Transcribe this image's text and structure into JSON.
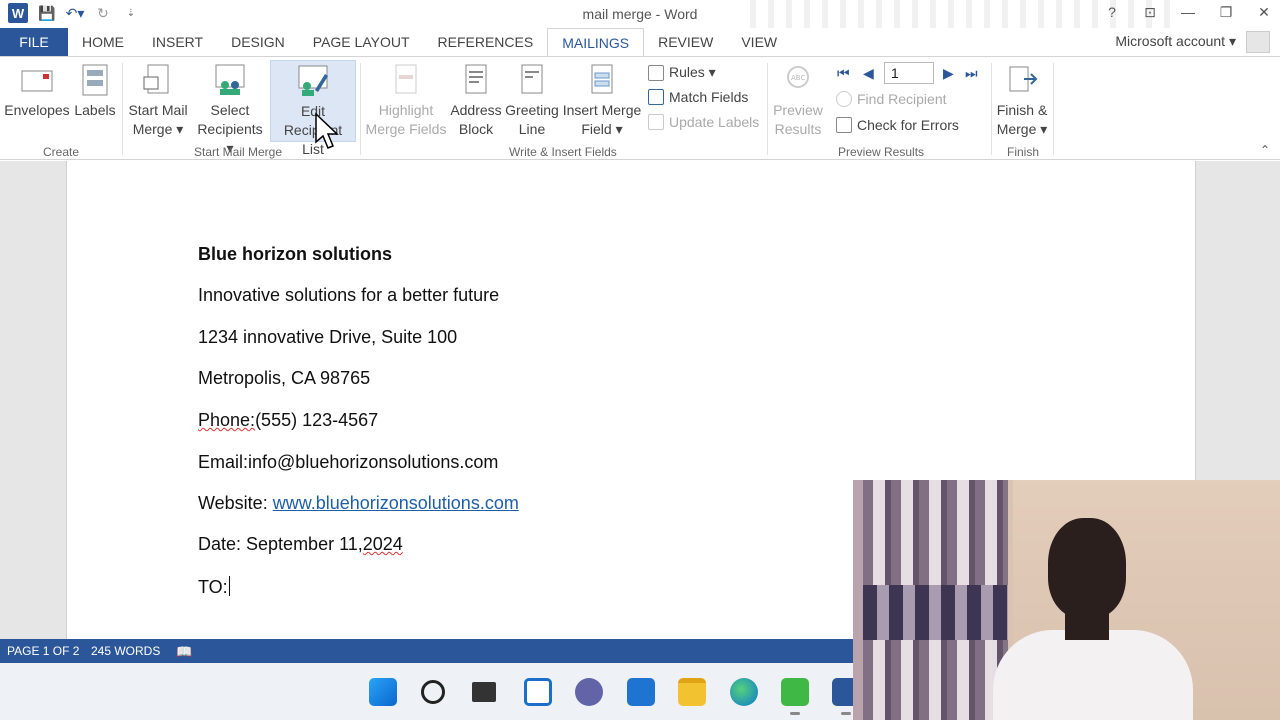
{
  "window": {
    "title": "mail merge - Word",
    "account": "Microsoft account",
    "help": "?",
    "controls": [
      "⊡",
      "—",
      "❐",
      "✕"
    ]
  },
  "tabs": [
    "FILE",
    "HOME",
    "INSERT",
    "DESIGN",
    "PAGE LAYOUT",
    "REFERENCES",
    "MAILINGS",
    "REVIEW",
    "VIEW"
  ],
  "active_tab": "MAILINGS",
  "ribbon": {
    "create": {
      "label": "Create",
      "envelopes": "Envelopes",
      "labels": "Labels"
    },
    "start": {
      "label": "Start Mail Merge",
      "start_mail_merge": [
        "Start Mail",
        "Merge ▾"
      ],
      "select_recipients": [
        "Select",
        "Recipients ▾"
      ],
      "edit_recipient_list": [
        "Edit",
        "Recipient List"
      ]
    },
    "write": {
      "label": "Write & Insert Fields",
      "highlight": [
        "Highlight",
        "Merge Fields"
      ],
      "address_block": [
        "Address",
        "Block"
      ],
      "greeting_line": [
        "Greeting",
        "Line"
      ],
      "insert_merge_field": [
        "Insert Merge",
        "Field ▾"
      ],
      "rules": "Rules ▾",
      "match_fields": "Match Fields",
      "update_labels": "Update Labels"
    },
    "preview": {
      "label": "Preview Results",
      "preview_results": [
        "Preview",
        "Results"
      ],
      "record": "1",
      "find_recipient": "Find Recipient",
      "check_errors": "Check for Errors"
    },
    "finish": {
      "label": "Finish",
      "finish_merge": [
        "Finish &",
        "Merge ▾"
      ]
    }
  },
  "document": {
    "company": "Blue horizon solutions",
    "tagline": "Innovative solutions for a better future",
    "address1": "1234 innovative Drive, Suite 100",
    "address2": "Metropolis, CA 98765",
    "phone_label": "Phone:",
    "phone_value": "(555) 123-4567",
    "email": "Email:info@bluehorizonsolutions.com",
    "website_label": "Website: ",
    "website_url": "www.bluehorizonsolutions.com",
    "date_prefix": "Date: September 11,",
    "date_year": "2024",
    "to": "TO:"
  },
  "status": {
    "page": "PAGE 1 OF 2",
    "words": "245 WORDS"
  },
  "colors": {
    "accent": "#2b579a",
    "link": "#1f5fa8",
    "statusbar": "#2b579a"
  },
  "taskbar_icons": [
    "windows-start-icon",
    "search-icon",
    "task-view-icon",
    "widgets-icon",
    "teams-icon",
    "store-icon",
    "file-explorer-icon",
    "edge-icon",
    "camtasia-icon",
    "word-icon"
  ]
}
